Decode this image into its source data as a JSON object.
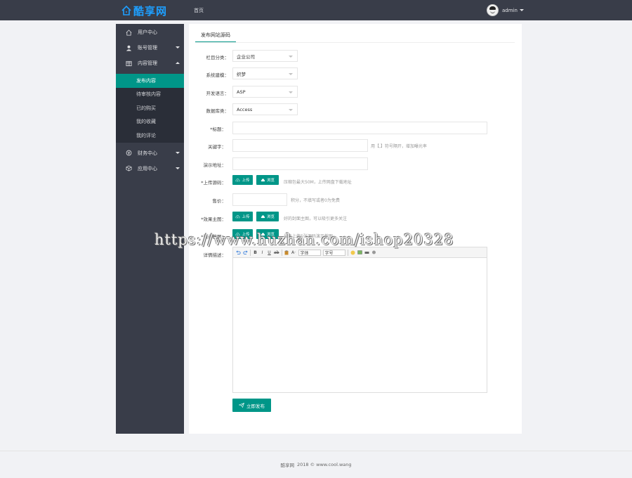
{
  "header": {
    "logo_text": "酷享网",
    "nav_home": "首页",
    "username": "admin"
  },
  "sidebar": {
    "items": [
      {
        "label": "用户中心",
        "icon": "home-icon"
      },
      {
        "label": "账号管理",
        "icon": "user-icon"
      },
      {
        "label": "内容管理",
        "icon": "table-icon"
      }
    ],
    "sub_items": [
      {
        "label": "发布内容",
        "active": true
      },
      {
        "label": "待审核内容",
        "active": false
      },
      {
        "label": "已的购买",
        "active": false
      },
      {
        "label": "我的收藏",
        "active": false
      },
      {
        "label": "我的评论",
        "active": false
      }
    ],
    "items_bottom": [
      {
        "label": "财务中心",
        "icon": "finance-icon"
      },
      {
        "label": "应用中心",
        "icon": "cube-icon"
      }
    ]
  },
  "tab": {
    "label": "发布网站源码"
  },
  "form": {
    "category": {
      "label": "栏目分类：",
      "value": "企业公司"
    },
    "system": {
      "label": "系统建模：",
      "value": "织梦"
    },
    "language": {
      "label": "开发语言：",
      "value": "ASP"
    },
    "database": {
      "label": "数据库类：",
      "value": "Access"
    },
    "title": {
      "label": "*标题："
    },
    "keywords": {
      "label": "关键字：",
      "hint": "用【,】符号隔开，增加曝光率"
    },
    "demo": {
      "label": "演示地址："
    },
    "upload": {
      "label": "*上传源码：",
      "hint": "压缩包最大50M，上传网盘下载地址"
    },
    "price": {
      "label": "售价：",
      "hint": "积分，不填写或者0为免费"
    },
    "cover": {
      "label": "*效果主图：",
      "hint": "好的封面主图，可以吸引更多关注"
    },
    "screenshots": {
      "label": "*演示截图：",
      "hint": "最多上传5张源码演示截图"
    },
    "detail": {
      "label": "详情描述："
    },
    "upload_btn": "上传",
    "browse_btn": "浏览",
    "font_select": "字体",
    "size_select": "字号",
    "submit": "立即发布"
  },
  "footer": {
    "brand": "酷享网",
    "copyright": "2018 © www.cool.wang"
  },
  "watermark": "https://www.huzhan.com/ishop20328",
  "colors": {
    "accent": "#009688",
    "dark": "#393d49",
    "logo": "#1e9fff"
  }
}
